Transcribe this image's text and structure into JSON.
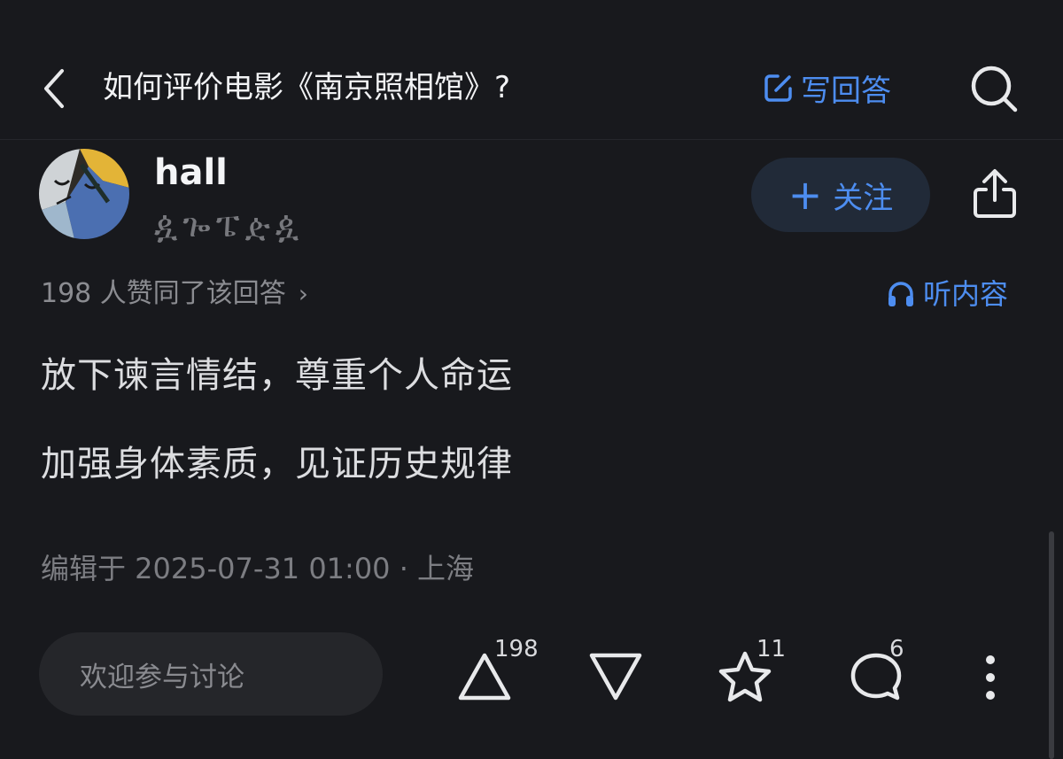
{
  "header": {
    "back_icon": "chevron-left-icon",
    "question_title": "如何评价电影《南京照相馆》?",
    "write_answer_label": "写回答",
    "write_icon": "edit-icon",
    "search_icon": "search-icon",
    "accent_color": "#4d8df0"
  },
  "author": {
    "name": "hall",
    "badge_text": "ዿጐፔዽዿ",
    "follow_label": "关注",
    "follow_plus": "+",
    "share_icon": "share-icon"
  },
  "answer": {
    "upvote_summary": "198 人赞同了该回答",
    "upvote_summary_chevron": "›",
    "listen_label": "听内容",
    "listen_icon": "headphones-icon",
    "paragraphs": [
      "放下谏言情结，尊重个人命运",
      "加强身体素质，见证历史规律"
    ],
    "edit_info": "编辑于 2025-07-31 01:00 · 上海"
  },
  "bottom_bar": {
    "comment_placeholder": "欢迎参与讨论",
    "upvote_count": "198",
    "favorite_count": "11",
    "comment_count": "6",
    "icons": [
      "upvote-icon",
      "downvote-icon",
      "star-icon",
      "comment-icon",
      "more-icon"
    ]
  },
  "colors": {
    "background": "#18191d",
    "text_primary": "#e8e9eb",
    "text_secondary": "#8b8c91",
    "accent": "#4d8df0"
  }
}
